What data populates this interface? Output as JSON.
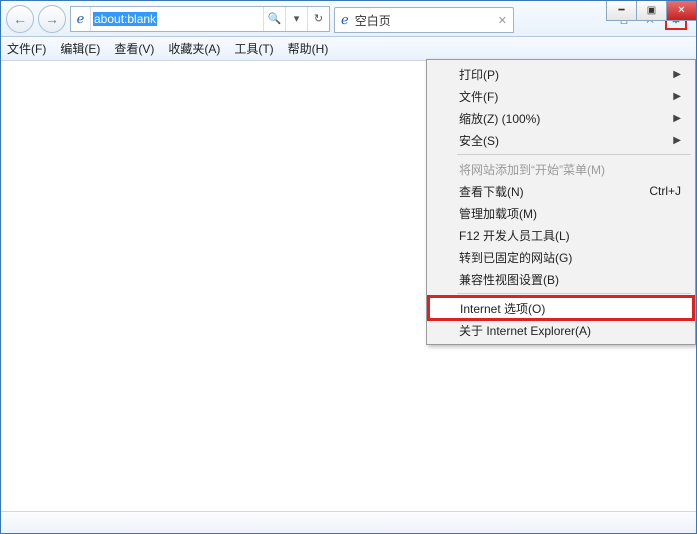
{
  "address": {
    "url": "about:blank"
  },
  "tab": {
    "title": "空白页"
  },
  "menubar": [
    "文件(F)",
    "编辑(E)",
    "查看(V)",
    "收藏夹(A)",
    "工具(T)",
    "帮助(H)"
  ],
  "dropdown": [
    {
      "label": "打印(P)"
    },
    {
      "label": "文件(F)"
    },
    {
      "label": "缩放(Z) (100%)"
    },
    {
      "label": "安全(S)"
    },
    {
      "label": "将网站添加到“开始”菜单(M)"
    },
    {
      "label": "查看下载(N)",
      "shortcut": "Ctrl+J"
    },
    {
      "label": "管理加载项(M)"
    },
    {
      "label": "F12 开发人员工具(L)"
    },
    {
      "label": "转到已固定的网站(G)"
    },
    {
      "label": "兼容性视图设置(B)"
    },
    {
      "label": "Internet 选项(O)"
    },
    {
      "label": "关于 Internet Explorer(A)"
    }
  ]
}
